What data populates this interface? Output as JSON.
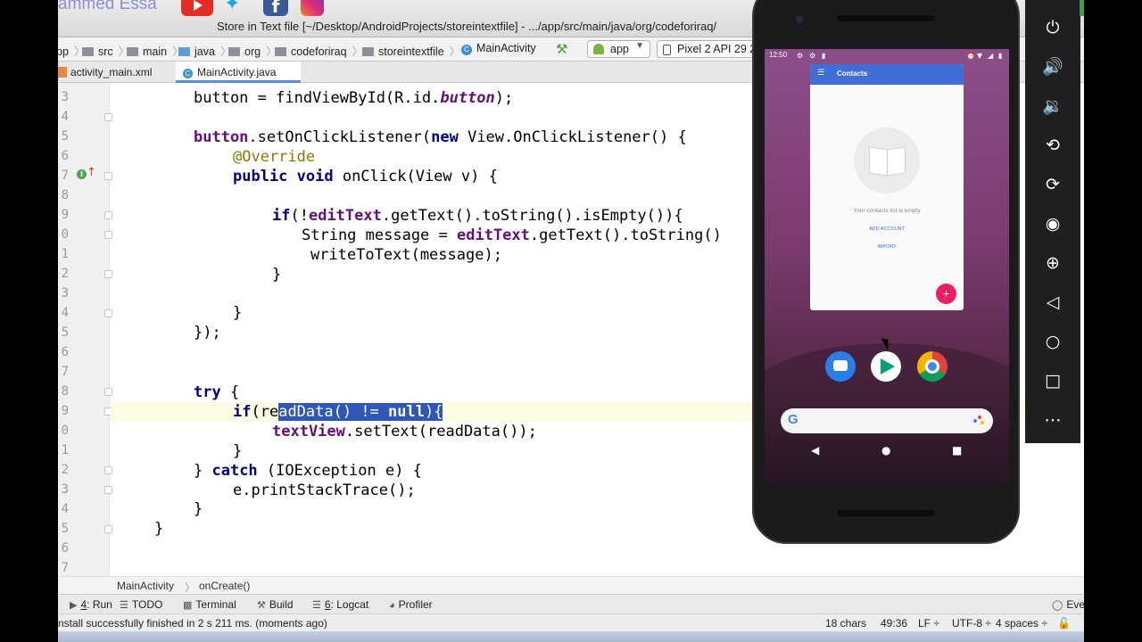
{
  "title_bar": {
    "channel_name": "ammed Essa",
    "window_title": "Store in Text file [~/Desktop/AndroidProjects/storeintextfile] - .../app/src/main/java/org/codeforiraq/"
  },
  "nav_bar": {
    "crumbs": [
      "pp",
      "src",
      "main",
      "java",
      "org",
      "codeforiraq",
      "storeintextfile",
      "MainActivity"
    ],
    "app_config": "app",
    "device": "Pixel 2 API 29 2"
  },
  "tabs": [
    {
      "label": "activity_main.xml",
      "active": false
    },
    {
      "label": "MainActivity.java",
      "active": true
    }
  ],
  "editor": {
    "line_numbers": [
      "3",
      "4",
      "5",
      "6",
      "7",
      "8",
      "9",
      "0",
      "1",
      "2",
      "3",
      "4",
      "5",
      "6",
      "7",
      "8",
      "9",
      "0",
      "1",
      "2",
      "3",
      "4",
      "5",
      "6",
      "7"
    ],
    "code_lines": {
      "l33_a": "button = findViewById(R.id.",
      "l33_b": "button",
      "l33_c": ");",
      "l35_a": "button",
      "l35_b": ".setOnClickListener(",
      "l35_c": "new",
      "l35_d": " View.OnClickListener() {",
      "l36": "@Override",
      "l37_a": "public void",
      "l37_b": " onClick(View v) {",
      "l39_a": "if",
      "l39_b": "(!",
      "l39_c": "editText",
      "l39_d": ".getText().toString().isEmpty()){",
      "l40_a": "String message = ",
      "l40_b": "editText",
      "l40_c": ".getText().toString()",
      "l41": "writeToText(message);",
      "l42": "}",
      "l44": "}",
      "l45": "});",
      "l48_a": "try",
      "l48_b": " {",
      "l49_a": "if",
      "l49_b": "(re",
      "l49_c": "adData() != ",
      "l49_d": "null",
      "l49_e": "){",
      "l50_a": "textView",
      "l50_b": ".setText(readData());",
      "l51": "}",
      "l52_a": "} ",
      "l52_b": "catch",
      "l52_c": " (IOException e) {",
      "l53": "e.printStackTrace();",
      "l54": "}",
      "l55": "}"
    }
  },
  "code_breadcrumbs": [
    "MainActivity",
    "onCreate()"
  ],
  "tool_windows": [
    {
      "num": "4",
      "label": ": Run"
    },
    {
      "num": "",
      "label": "TODO"
    },
    {
      "num": "",
      "label": "Terminal"
    },
    {
      "num": "",
      "label": "Build"
    },
    {
      "num": "6",
      "label": ": Logcat"
    },
    {
      "num": "",
      "label": "Profiler"
    },
    {
      "num": "",
      "label": "Eve"
    }
  ],
  "status": {
    "message": "nstall successfully finished in 2 s 211 ms. (moments ago)",
    "chars": "18 chars",
    "position": "49:36",
    "line_sep": "LF ÷",
    "encoding": "UTF-8 ÷",
    "indent": "4 spaces ÷"
  },
  "phone": {
    "time": "12:50",
    "app_title": "Contacts",
    "empty_text": "Your contacts list is empty",
    "add_account": "ADD ACCOUNT",
    "import": "IMPORT",
    "fab": "+",
    "search_logo": "G"
  },
  "emulator_controls": [
    "power-icon",
    "volume-up-icon",
    "volume-down-icon",
    "rotate-left-icon",
    "rotate-right-icon",
    "camera-icon",
    "zoom-icon",
    "back-icon",
    "home-icon",
    "overview-icon",
    "more-icon"
  ]
}
